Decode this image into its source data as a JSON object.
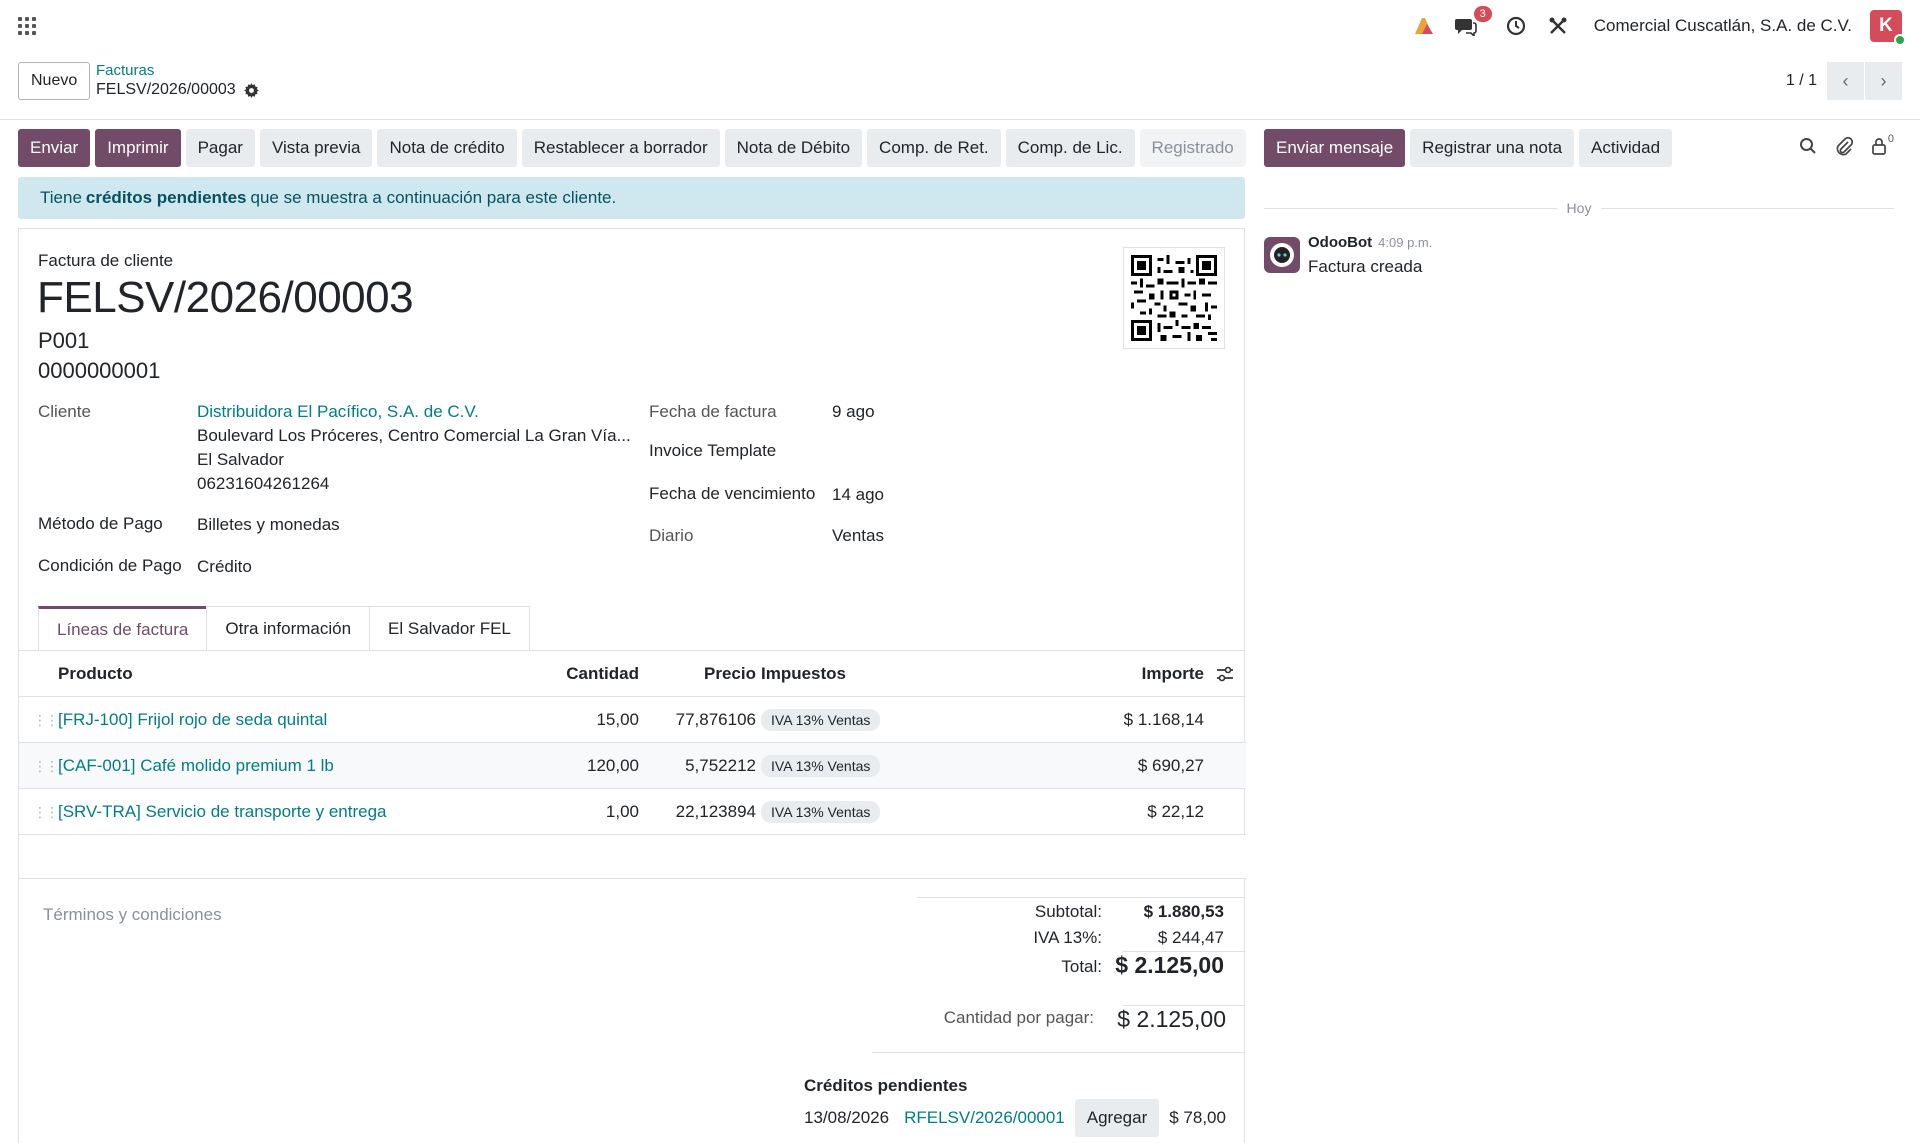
{
  "navbar": {
    "company": "Comercial Cuscatlán, S.A. de C.V.",
    "messages_count": "3",
    "avatar_letter": "K",
    "icons": [
      "apps-icon",
      "app-logo-icon",
      "chat-icon",
      "clock-icon",
      "tools-icon"
    ]
  },
  "control": {
    "new_label": "Nuevo",
    "breadcrumb_parent": "Facturas",
    "breadcrumb_current": "FELSV/2026/00003",
    "pager": "1 / 1"
  },
  "actions": {
    "send": "Enviar",
    "print": "Imprimir",
    "pay": "Pagar",
    "preview": "Vista previa",
    "credit_note": "Nota de crédito",
    "reset_draft": "Restablecer a borrador",
    "debit_note": "Nota de Débito",
    "comp_ret": "Comp. de Ret.",
    "comp_lic": "Comp. de Lic.",
    "status": "Registrado"
  },
  "chatter": {
    "send_message": "Enviar mensaje",
    "log_note": "Registrar una nota",
    "activity": "Actividad",
    "followers_count": "0",
    "today": "Hoy",
    "author": "OdooBot",
    "time": "4:09 p.m.",
    "body": "Factura creada"
  },
  "alert": {
    "prefix": "Tiene",
    "bold": "créditos pendientes",
    "suffix": "que se muestra a continuación para este cliente."
  },
  "invoice": {
    "type": "Factura de cliente",
    "number": "FELSV/2026/00003",
    "sub1": "P001",
    "sub2": "0000000001",
    "customer_label": "Cliente",
    "customer_name": "Distribuidora El Pacífico, S.A. de C.V.",
    "customer_addr1": "Boulevard Los Próceres, Centro Comercial La Gran Vía...",
    "customer_addr2": "El Salvador",
    "customer_addr3": "06231604261264",
    "payment_method_label": "Método de Pago",
    "payment_method": "Billetes y monedas",
    "payment_condition_label": "Condición de Pago",
    "payment_condition": "Crédito",
    "invoice_date_label": "Fecha de factura",
    "invoice_date": "9 ago",
    "template_label": "Invoice Template",
    "due_date_label": "Fecha de vencimiento",
    "due_date": "14 ago",
    "journal_label": "Diario",
    "journal": "Ventas"
  },
  "tabs": [
    "Líneas de factura",
    "Otra información",
    "El Salvador FEL"
  ],
  "table": {
    "headers": {
      "product": "Producto",
      "qty": "Cantidad",
      "price": "Precio",
      "taxes": "Impuestos",
      "amount": "Importe"
    },
    "rows": [
      {
        "product": "[FRJ-100] Frijol rojo de seda quintal",
        "qty": "15,00",
        "price": "77,876106",
        "tax": "IVA 13% Ventas",
        "amount": "$ 1.168,14"
      },
      {
        "product": "[CAF-001] Café molido premium 1 lb",
        "qty": "120,00",
        "price": "5,752212",
        "tax": "IVA 13% Ventas",
        "amount": "$ 690,27"
      },
      {
        "product": "[SRV-TRA] Servicio de transporte y entrega",
        "qty": "1,00",
        "price": "22,123894",
        "tax": "IVA 13% Ventas",
        "amount": "$ 22,12"
      }
    ]
  },
  "totals": {
    "terms_placeholder": "Términos y condiciones",
    "subtotal_label": "Subtotal:",
    "subtotal": "$ 1.880,53",
    "iva_label": "IVA 13%:",
    "iva": "$ 244,47",
    "total_label": "Total:",
    "total": "$ 2.125,00",
    "due_label": "Cantidad por pagar:",
    "due": "$ 2.125,00"
  },
  "credits": {
    "title": "Créditos pendientes",
    "date": "13/08/2026",
    "ref": "RFELSV/2026/00001",
    "add_label": "Agregar",
    "amount": "$ 78,00"
  },
  "colors": {
    "primary": "#714b67",
    "link": "#017e84",
    "alert_bg": "#cfe8ef",
    "badge": "#d44c59"
  }
}
